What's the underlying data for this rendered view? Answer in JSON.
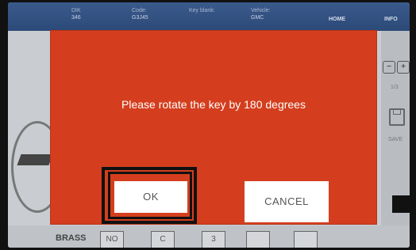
{
  "header": {
    "cells": [
      {
        "label": "DIK",
        "value": "346"
      },
      {
        "label": "Code:",
        "value": "G3J45"
      },
      {
        "label": "Key blank:",
        "value": ""
      },
      {
        "label": "Vehicle:",
        "value": "GMC"
      }
    ],
    "home_label": "HOME",
    "info_label": "INFO"
  },
  "side": {
    "page_indicator": "1/3",
    "save_label": "SAVE"
  },
  "bottom": {
    "material_label": "BRASS",
    "tiles": [
      "NO",
      "C",
      "3",
      "",
      ""
    ]
  },
  "dialog": {
    "message": "Please rotate the key by 180 degrees",
    "ok_label": "OK",
    "cancel_label": "CANCEL"
  },
  "colors": {
    "dialog_bg": "#d43e1e",
    "header_bg": "#2c4a78"
  }
}
